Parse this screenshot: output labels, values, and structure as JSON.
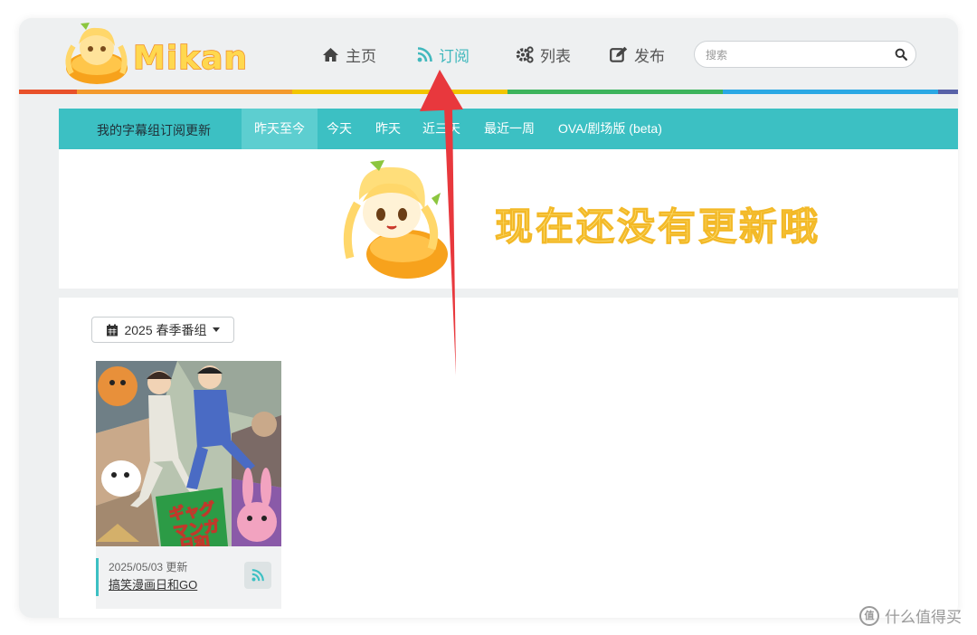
{
  "header": {
    "logo_text": "Mikan",
    "nav": [
      {
        "label": "主页",
        "icon": "home-icon"
      },
      {
        "label": "订阅",
        "icon": "rss-icon",
        "active": true
      },
      {
        "label": "列表",
        "icon": "gears-icon"
      },
      {
        "label": "发布",
        "icon": "edit-icon"
      }
    ],
    "search_placeholder": "搜索",
    "rainbow_colors": [
      "#e8512a",
      "#f39a2d",
      "#f2c500",
      "#3db45c",
      "#2ba8e4",
      "#5862a8"
    ]
  },
  "subnav": {
    "title": "我的字幕组订阅更新",
    "tabs": [
      {
        "label": "昨天至今",
        "active": true
      },
      {
        "label": "今天"
      },
      {
        "label": "昨天"
      },
      {
        "label": "近三天"
      },
      {
        "label": "最近一周"
      },
      {
        "label": "OVA/剧场版 (beta)"
      }
    ]
  },
  "banner": {
    "message": "现在还没有更新哦"
  },
  "season_selector": {
    "label": "2025 春季番组"
  },
  "cards": [
    {
      "date": "2025/05/03 更新",
      "title": "搞笑漫画日和GO",
      "poster_text": "ギャグマンガ日和GO"
    }
  ],
  "watermark": {
    "text": "什么值得买",
    "icon_char": "值"
  },
  "colors": {
    "accent": "#3cc0c3",
    "annotation_arrow": "#e8383d"
  }
}
